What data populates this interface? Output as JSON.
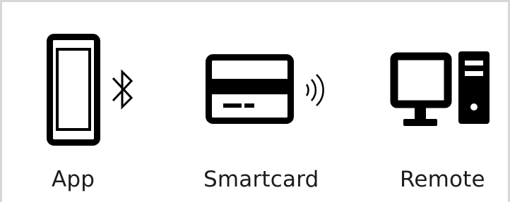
{
  "options": [
    {
      "label": "App",
      "icon": "phone-bluetooth-icon"
    },
    {
      "label": "Smartcard",
      "icon": "smartcard-contactless-icon"
    },
    {
      "label": "Remote",
      "icon": "desktop-computer-icon"
    }
  ],
  "colors": {
    "icon": "#000000",
    "text": "#1c1c1c",
    "border": "#d7d7d7",
    "background": "#ffffff"
  }
}
